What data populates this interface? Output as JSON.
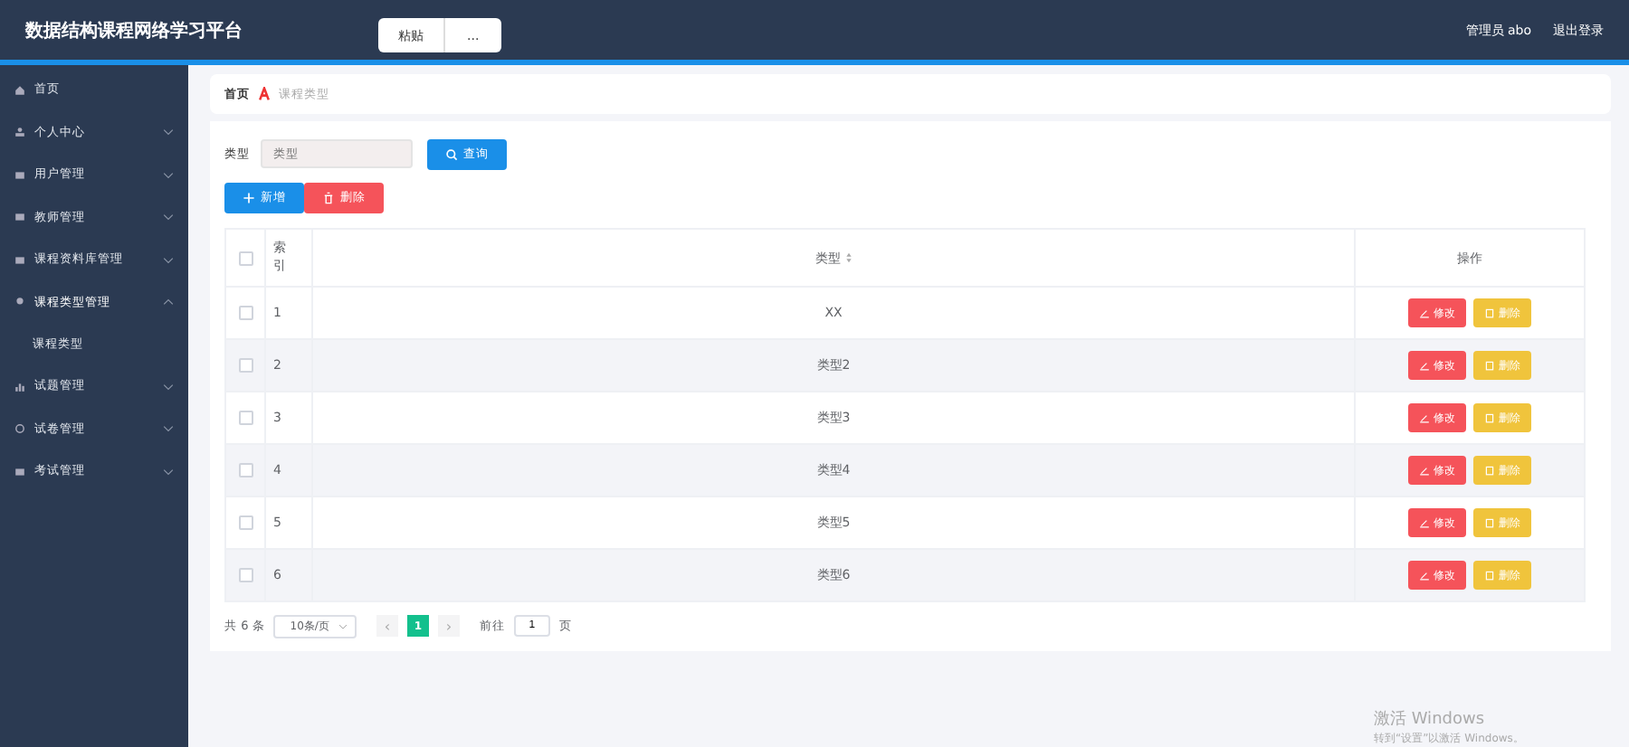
{
  "header": {
    "title": "数据结构课程网络学习平台",
    "popup": [
      "粘贴",
      "..."
    ],
    "user": "管理员 abo",
    "logout": "退出登录"
  },
  "sidebar": {
    "items": [
      {
        "label": "首页",
        "kind": "link"
      },
      {
        "label": "个人中心",
        "kind": "menu",
        "expanded": false
      },
      {
        "label": "用户管理",
        "kind": "menu",
        "expanded": false
      },
      {
        "label": "教师管理",
        "kind": "menu",
        "expanded": false
      },
      {
        "label": "课程资料库管理",
        "kind": "menu",
        "expanded": false
      },
      {
        "label": "课程类型管理",
        "kind": "menu",
        "expanded": true,
        "children": [
          {
            "label": "课程类型"
          }
        ]
      },
      {
        "label": "试题管理",
        "kind": "menu",
        "expanded": false
      },
      {
        "label": "试卷管理",
        "kind": "menu",
        "expanded": false
      },
      {
        "label": "考试管理",
        "kind": "menu",
        "expanded": false
      }
    ]
  },
  "breadcrumb": [
    "首页",
    "课程类型"
  ],
  "search": {
    "label": "类型",
    "placeholder": "类型",
    "button": "查询"
  },
  "actions": {
    "add": "新增",
    "delete": "删除"
  },
  "table": {
    "all_selected": false,
    "columns": [
      "索引",
      "类型",
      "操作"
    ],
    "rows": [
      {
        "index": "1",
        "type": "XX",
        "selected": false,
        "edit": "修改",
        "delete": "删除"
      },
      {
        "index": "2",
        "type": "类型2",
        "selected": false,
        "edit": "修改",
        "delete": "删除"
      },
      {
        "index": "3",
        "type": "类型3",
        "selected": false,
        "edit": "修改",
        "delete": "删除"
      },
      {
        "index": "4",
        "type": "类型4",
        "selected": false,
        "edit": "修改",
        "delete": "删除"
      },
      {
        "index": "5",
        "type": "类型5",
        "selected": false,
        "edit": "修改",
        "delete": "删除"
      },
      {
        "index": "6",
        "type": "类型6",
        "selected": false,
        "edit": "修改",
        "delete": "删除"
      }
    ]
  },
  "pagination": {
    "total": "共 6 条",
    "page_size": "10条/页",
    "prev": "‹",
    "pages": [
      {
        "label": "1",
        "selected": true
      }
    ],
    "next": "›",
    "goto": "前往",
    "goto_value": "1",
    "goto_unit": "页"
  },
  "os_notice": {
    "title": "激活 Windows",
    "text": "转到“设置”以激活 Windows。"
  }
}
